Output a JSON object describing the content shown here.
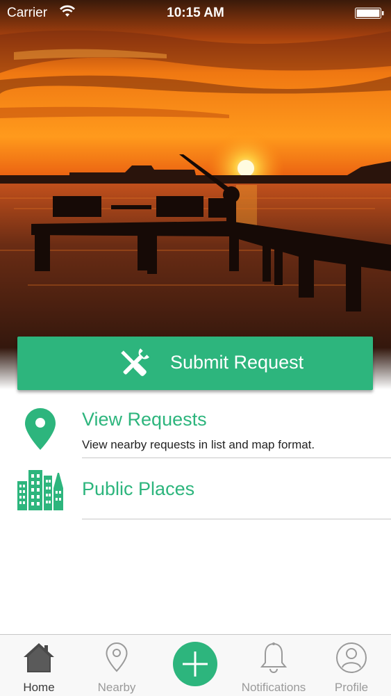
{
  "status_bar": {
    "carrier": "Carrier",
    "time": "10:15 AM"
  },
  "hero": {
    "image": "sunset-over-pier"
  },
  "submit": {
    "label": "Submit Request",
    "icon": "wrench-screwdriver-icon"
  },
  "menu": {
    "view_requests": {
      "title": "View Requests",
      "subtitle": "View nearby requests in list and map format.",
      "icon": "map-pin-icon"
    },
    "public_places": {
      "title": "Public Places",
      "icon": "city-buildings-icon"
    }
  },
  "tabs": [
    {
      "label": "Home",
      "icon": "home-icon",
      "active": true
    },
    {
      "label": "Nearby",
      "icon": "location-pin-icon",
      "active": false
    },
    {
      "label": "",
      "icon": "plus-icon",
      "active": false
    },
    {
      "label": "Notifications",
      "icon": "bell-icon",
      "active": false
    },
    {
      "label": "Profile",
      "icon": "profile-icon",
      "active": false
    }
  ],
  "colors": {
    "accent": "#2db57d",
    "tab_active": "#3a3a3a",
    "tab_inactive": "#9a9a9a"
  }
}
